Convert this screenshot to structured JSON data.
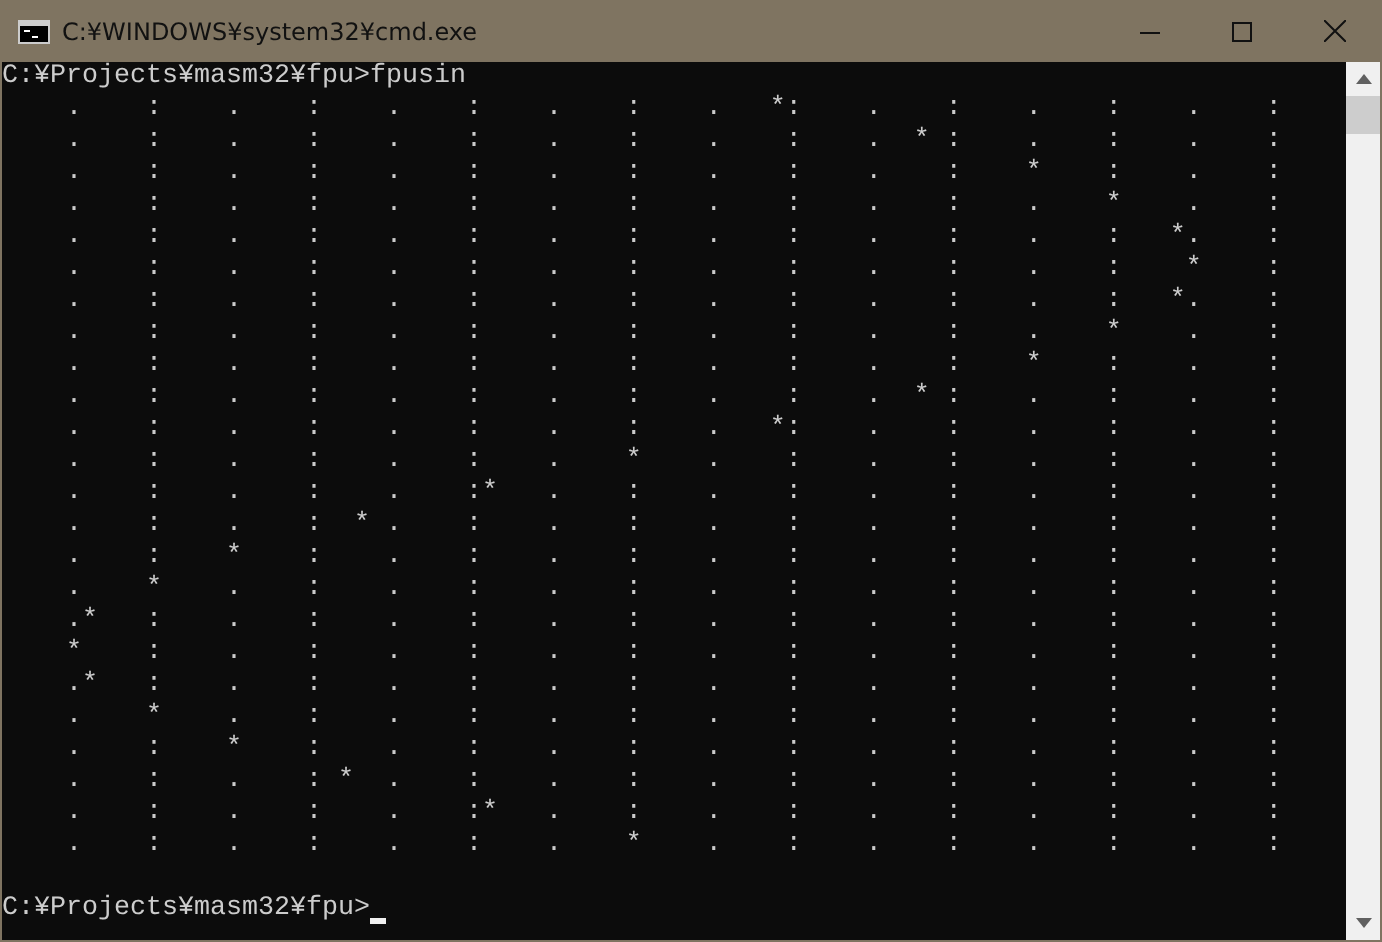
{
  "window": {
    "title": "C:¥WINDOWS¥system32¥cmd.exe"
  },
  "console": {
    "lines": [
      "C:¥Projects¥masm32¥fpu>fpusin",
      "    .    :    .    :    .    :    .    :    .   *:    .    :    .    :    .    :",
      "    .    :    .    :    .    :    .    :    .    :    .  * :    .    :    .    :",
      "    .    :    .    :    .    :    .    :    .    :    .    :    *    :    .    :",
      "    .    :    .    :    .    :    .    :    .    :    .    :    .    *    .    :",
      "    .    :    .    :    .    :    .    :    .    :    .    :    .    :   *.    :",
      "    .    :    .    :    .    :    .    :    .    :    .    :    .    :    *    :",
      "    .    :    .    :    .    :    .    :    .    :    .    :    .    :   *.    :",
      "    .    :    .    :    .    :    .    :    .    :    .    :    .    *    .    :",
      "    .    :    .    :    .    :    .    :    .    :    .    :    *    :    .    :",
      "    .    :    .    :    .    :    .    :    .    :    .  * :    .    :    .    :",
      "    .    :    .    :    .    :    .    :    .   *:    .    :    .    :    .    :",
      "    .    :    .    :    .    :    .    *    .    :    .    :    .    :    .    :",
      "    .    :    .    :    .    :*   .    :    .    :    .    :    .    :    .    :",
      "    .    :    .    :  * .    :    .    :    .    :    .    :    .    :    .    :",
      "    .    :    *    :    .    :    .    :    .    :    .    :    .    :    .    :",
      "    .    *    .    :    .    :    .    :    .    :    .    :    .    :    .    :",
      "    .*   :    .    :    .    :    .    :    .    :    .    :    .    :    .    :",
      "    *    :    .    :    .    :    .    :    .    :    .    :    .    :    .    :",
      "    .*   :    .    :    .    :    .    :    .    :    .    :    .    :    .    :",
      "    .    *    .    :    .    :    .    :    .    :    .    :    .    :    .    :",
      "    .    :    *    :    .    :    .    :    .    :    .    :    .    :    .    :",
      "    .    :    .    : *  .    :    .    :    .    :    .    :    .    :    .    :",
      "    .    :    .    :    .    :*   .    :    .    :    .    :    .    :    .    :",
      "    .    :    .    :    .    :    .    *    .    :    .    :    .    :    .    :"
    ],
    "prompt": "C:¥Projects¥masm32¥fpu>"
  }
}
